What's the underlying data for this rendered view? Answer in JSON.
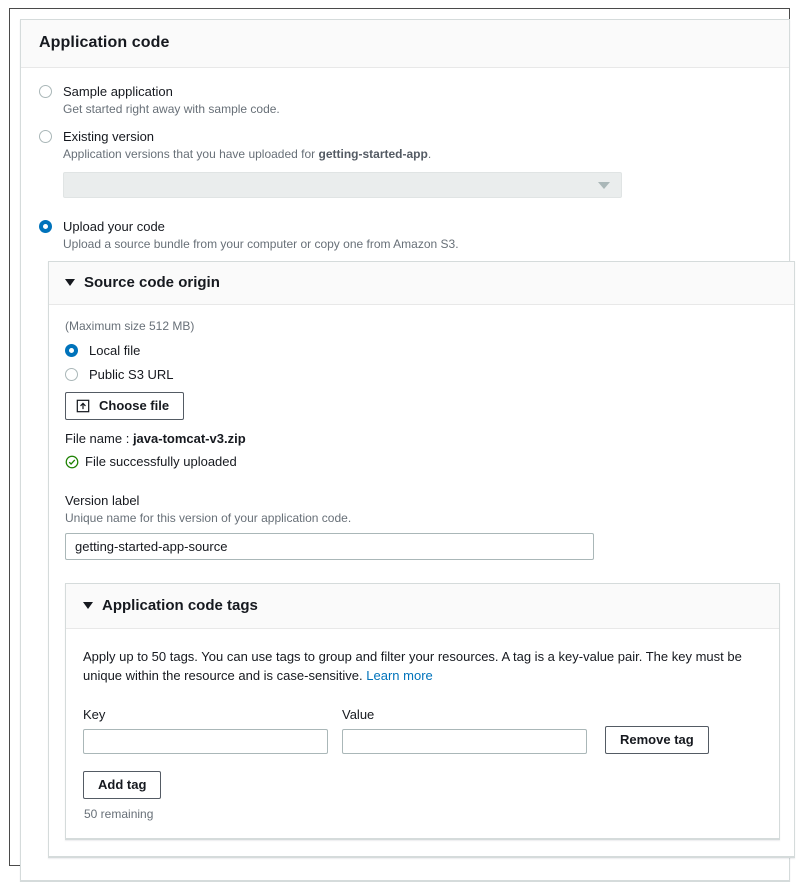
{
  "card": {
    "title": "Application code"
  },
  "code_options": [
    {
      "id": "sample-application",
      "label": "Sample application",
      "description": "Get started right away with sample code.",
      "selected": false
    },
    {
      "id": "existing-version",
      "label": "Existing version",
      "description_prefix": "Application versions that you have uploaded for ",
      "description_strong": "getting-started-app",
      "description_suffix": ".",
      "selected": false
    },
    {
      "id": "upload-your-code",
      "label": "Upload your code",
      "description": "Upload a source bundle from your computer or copy one from Amazon S3.",
      "selected": true
    }
  ],
  "existing_version_select": {
    "value": "",
    "placeholder": "",
    "disabled": true,
    "caret_icon": "chevron-down-icon"
  },
  "source_panel": {
    "title": "Source code origin",
    "expanded": true,
    "toggle_icon": "triangle-down-icon",
    "max_size_note": "(Maximum size 512 MB)",
    "origin_options": [
      {
        "id": "local-file",
        "label": "Local file",
        "selected": true
      },
      {
        "id": "public-s3-url",
        "label": "Public S3 URL",
        "selected": false
      }
    ],
    "choose_file_label": "Choose file",
    "choose_file_icon": "upload-icon",
    "file_name_label": "File name :",
    "file_name_value": "java-tomcat-v3.zip",
    "upload_status_icon": "success-check-icon",
    "upload_status_text": "File successfully uploaded",
    "version_label": {
      "label": "Version label",
      "hint": "Unique name for this version of your application code.",
      "value": "getting-started-app-source",
      "placeholder": ""
    }
  },
  "tags_panel": {
    "title": "Application code tags",
    "expanded": true,
    "toggle_icon": "triangle-down-icon",
    "description": "Apply up to 50 tags. You can use tags to group and filter your resources. A tag is a key-value pair. The key must be unique within the resource and is case-sensitive.",
    "learn_more_label": "Learn more",
    "key_column_label": "Key",
    "value_column_label": "Value",
    "rows": [
      {
        "key": "",
        "value": "",
        "remove_label": "Remove tag"
      }
    ],
    "add_tag_label": "Add tag",
    "remaining_text": "50 remaining"
  },
  "colors": {
    "accent_blue": "#0073bb",
    "success_green": "#1d8102",
    "panel_border": "#d5dbdb",
    "header_bg": "#fafafa",
    "muted_text": "#687078",
    "disabled_bg": "#eaeded"
  }
}
